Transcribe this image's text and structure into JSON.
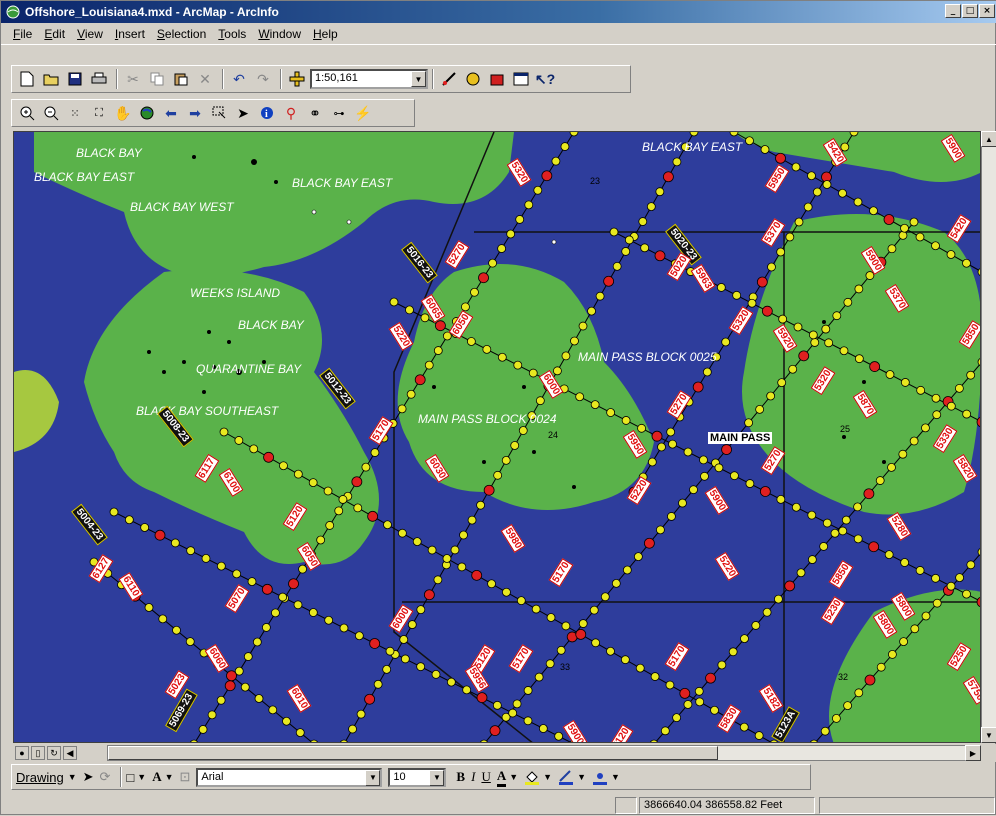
{
  "window": {
    "title": "Offshore_Louisiana4.mxd - ArcMap - ArcInfo",
    "minimize": "_",
    "maximize": "□",
    "close": "×"
  },
  "menu": [
    "File",
    "Edit",
    "View",
    "Insert",
    "Selection",
    "Tools",
    "Window",
    "Help"
  ],
  "standard_toolbar": {
    "scale": "1:50,161"
  },
  "map": {
    "area_labels": [
      "BLACK BAY",
      "BLACK BAY EAST",
      "BLACK BAY EAST",
      "BLACK BAY WEST",
      "WEEKS ISLAND",
      "BLACK BAY",
      "QUARANTINE BAY",
      "BLACK BAY SOUTHEAST",
      "BLACK BAY EAST",
      "MAIN PASS BLOCK 0025",
      "MAIN PASS BLOCK 0024"
    ],
    "place_label": "MAIN PASS",
    "block_numbers": [
      "23",
      "24",
      "25",
      "32",
      "33"
    ],
    "line_ids": [
      "5016-23",
      "5012-23",
      "5008-23",
      "5004-23",
      "5020-23",
      "5069-23",
      "5123A"
    ],
    "lease_labels": [
      "5320",
      "5270",
      "6065",
      "6050",
      "5220",
      "5170",
      "6000",
      "6117",
      "6100",
      "5120",
      "6050",
      "6127",
      "6110",
      "5070",
      "6060",
      "5023",
      "6010",
      "6000",
      "5980",
      "5170",
      "6030",
      "5270",
      "5950",
      "5220",
      "5900",
      "5020",
      "5963",
      "5320",
      "5920",
      "5370",
      "5900",
      "5950",
      "5420",
      "5420",
      "5370",
      "5850",
      "5900",
      "5320",
      "5870",
      "5330",
      "5820",
      "5270",
      "5280",
      "5850",
      "5220",
      "5230",
      "5800",
      "5250",
      "5750",
      "5120",
      "5956",
      "5170",
      "5182",
      "5830",
      "5900",
      "5120",
      "5800",
      "5170"
    ]
  },
  "drawing_toolbar": {
    "menu": "Drawing",
    "font": "Arial",
    "size": "10",
    "bold": "B",
    "italic": "I",
    "underline": "U",
    "text_color": "A"
  },
  "status": {
    "coordinates": "3866640.04  386558.82 Feet"
  },
  "colors": {
    "water": "#2e3d9c",
    "land": "#5ab24a",
    "well_yellow": "#e8e820",
    "well_red": "#e02020"
  }
}
